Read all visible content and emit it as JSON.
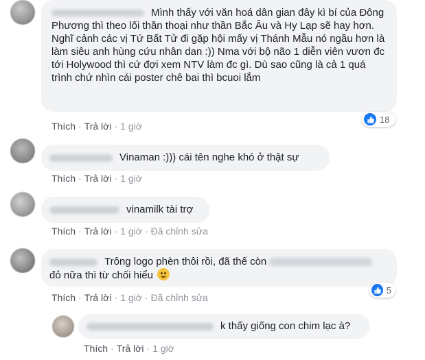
{
  "comments": [
    {
      "text": "Mình thấy với văn hoá dân gian đây kì bí của Đông Phương thì theo lối thần thoại như thần Bắc Âu và Hy Lạp sẽ hay hơn. Nghĩ cảnh các vị Tứ Bất Tử đi gặp hội mấy vị Thánh Mẫu nó ngầu hơn là làm siêu anh hùng cứu nhân dan :)) Nma với bộ não 1 diễn viên vươn đc tới Holywood thì cứ đợi xem NTV làm đc gì. Dù sao cũng là cả 1 quá trình chứ nhìn cái poster chê bai thì bcuoi lắm",
      "actions": {
        "like": "Thích",
        "reply": "Trả lời",
        "time": "1 giờ"
      },
      "reaction_count": "18"
    },
    {
      "text": "Vinaman :))) cái tên nghe khó ở thật sự",
      "actions": {
        "like": "Thích",
        "reply": "Trả lời",
        "time": "1 giờ"
      }
    },
    {
      "text": "vinamilk tài trợ",
      "actions": {
        "like": "Thích",
        "reply": "Trả lời",
        "time": "1 giờ",
        "edited": "Đã chỉnh sửa"
      }
    },
    {
      "text_before": "Trông logo phèn thôi rồi, đã thế còn",
      "text_after": "đỏ nữa thì từ chối hiểu",
      "emoji": "slightly-smiling-face",
      "actions": {
        "like": "Thích",
        "reply": "Trả lời",
        "time": "1 giờ",
        "edited": "Đã chỉnh sửa"
      },
      "reaction_count": "5"
    }
  ],
  "reply": {
    "text": "k thấy giống con chim lạc à?",
    "actions": {
      "like": "Thích",
      "reply": "Trả lời",
      "time": "1 giờ"
    }
  },
  "colors": {
    "bubble": "#f2f3f5",
    "like_blue": "#1877f2",
    "action_text": "#4b4f56",
    "muted": "#90949c"
  },
  "icons": {
    "like": "like-thumb-icon",
    "emoji": "slightly-smiling-face-emoji"
  }
}
